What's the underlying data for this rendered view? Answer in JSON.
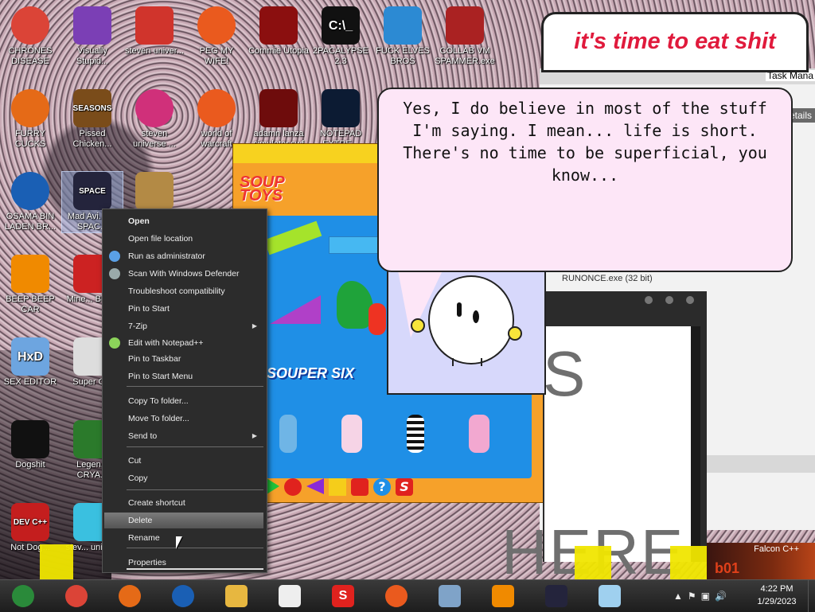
{
  "desktop": {
    "icons": [
      {
        "label": "CHRONES DISEASE",
        "icon": "chrome-icon"
      },
      {
        "label": "Visually Stupid...",
        "icon": "visual-studio-icon"
      },
      {
        "label": "steven univer...",
        "icon": "steven-universe-2-icon"
      },
      {
        "label": "PEG MY WIFE!",
        "icon": "peggle-icon"
      },
      {
        "label": "Commie Utopia",
        "icon": "commie-utopia-icon"
      },
      {
        "label": "2PACALYPSE 2.3",
        "icon": "console-icon",
        "glyph": "C:\\_"
      },
      {
        "label": "FUCK ELVES BROS",
        "icon": "elves-icon"
      },
      {
        "label": "COLLAB VM SPAMMER.exe",
        "icon": "collab-vm-icon"
      },
      {
        "label": "FURRY CUCKS",
        "icon": "firefox-icon"
      },
      {
        "label": "Pissed Chicken...",
        "icon": "angry-birds-seasons-icon",
        "glyph": "SEASONS"
      },
      {
        "label": "steven universe ...",
        "icon": "steven-universe-gem-icon"
      },
      {
        "label": "world of warcraft",
        "icon": "peggle-icon"
      },
      {
        "label": "adamn lanza simulator.swf",
        "icon": "flash-icon"
      },
      {
        "label": "NOTEPAD EXTRE...",
        "icon": "notepad-extreme-icon"
      },
      {
        "label": "OSAMA BIN LADEN BR...",
        "icon": "obama-logo-icon"
      },
      {
        "label": "Mad Avi... IN SPAC...",
        "icon": "angry-birds-space-icon",
        "glyph": "SPACE"
      },
      {
        "label": "",
        "icon": "money-bag-icon"
      },
      {
        "label": "BEEP BEEP CAR",
        "icon": "vlc-icon"
      },
      {
        "label": "Mine... Bird...",
        "icon": "angry-birds-icon"
      },
      {
        "label": "SEX EDITOR",
        "icon": "hxd-icon",
        "glyph": "HxD"
      },
      {
        "label": "Super C...",
        "icon": "super-icon"
      },
      {
        "label": "Dogshit",
        "icon": "dogshit-icon"
      },
      {
        "label": "Legen... CRYA...",
        "icon": "legend-icon"
      },
      {
        "label": "Not Dog...",
        "icon": "devcpp-icon",
        "glyph": "DEV C++"
      },
      {
        "label": "stev... unive...",
        "icon": "steven-gem-icon"
      }
    ]
  },
  "sticker": {
    "text": "it's time to eat shit"
  },
  "taskmgr": {
    "title": "Task Mana",
    "tab": "etails",
    "process": "RUNONCE.exe (32 bit)"
  },
  "soup": {
    "logo_line1": "SOUP",
    "logo_line2": "TOYS",
    "souper": "SOUPER SIX"
  },
  "speech": {
    "text": "Yes, I do believe in most of the stuff I'm saying. I mean... life is short. There's no time to be superficial, you know..."
  },
  "docwin": {
    "big_s": "S",
    "here": "HERE",
    "ob": "b01"
  },
  "falcon": {
    "label": "Falcon C++"
  },
  "context_menu": {
    "items": [
      {
        "label": "Open",
        "bold": true
      },
      {
        "label": "Open file location"
      },
      {
        "label": "Run as administrator",
        "icon": "shield-gear-icon"
      },
      {
        "label": "Scan With Windows Defender",
        "icon": "defender-icon"
      },
      {
        "label": "Troubleshoot compatibility"
      },
      {
        "label": "Pin to Start"
      },
      {
        "label": "7-Zip",
        "submenu": true
      },
      {
        "label": "Edit with Notepad++",
        "icon": "notepadpp-icon"
      },
      {
        "label": "Pin to Taskbar"
      },
      {
        "label": "Pin to Start Menu"
      },
      {
        "label": "Copy To folder..."
      },
      {
        "label": "Move To folder..."
      },
      {
        "label": "Send to",
        "submenu": true
      },
      {
        "label": "Cut"
      },
      {
        "label": "Copy"
      },
      {
        "label": "Create shortcut"
      },
      {
        "label": "Delete",
        "highlighted": true
      },
      {
        "label": "Rename"
      },
      {
        "label": "Properties"
      }
    ]
  },
  "taskbar": {
    "items": [
      {
        "icon": "start-orb-icon"
      },
      {
        "icon": "chrome-icon"
      },
      {
        "icon": "firefox-icon"
      },
      {
        "icon": "obama-logo-icon"
      },
      {
        "icon": "file-explorer-icon"
      },
      {
        "icon": "bunny-icon"
      },
      {
        "icon": "s-logo-icon",
        "glyph": "S"
      },
      {
        "icon": "peggle-icon"
      },
      {
        "icon": "task-manager-icon"
      },
      {
        "icon": "vlc-icon"
      },
      {
        "icon": "angry-birds-space-icon"
      },
      {
        "icon": "notepad-icon"
      }
    ],
    "clock_time": "4:22 PM",
    "clock_date": "1/29/2023"
  }
}
